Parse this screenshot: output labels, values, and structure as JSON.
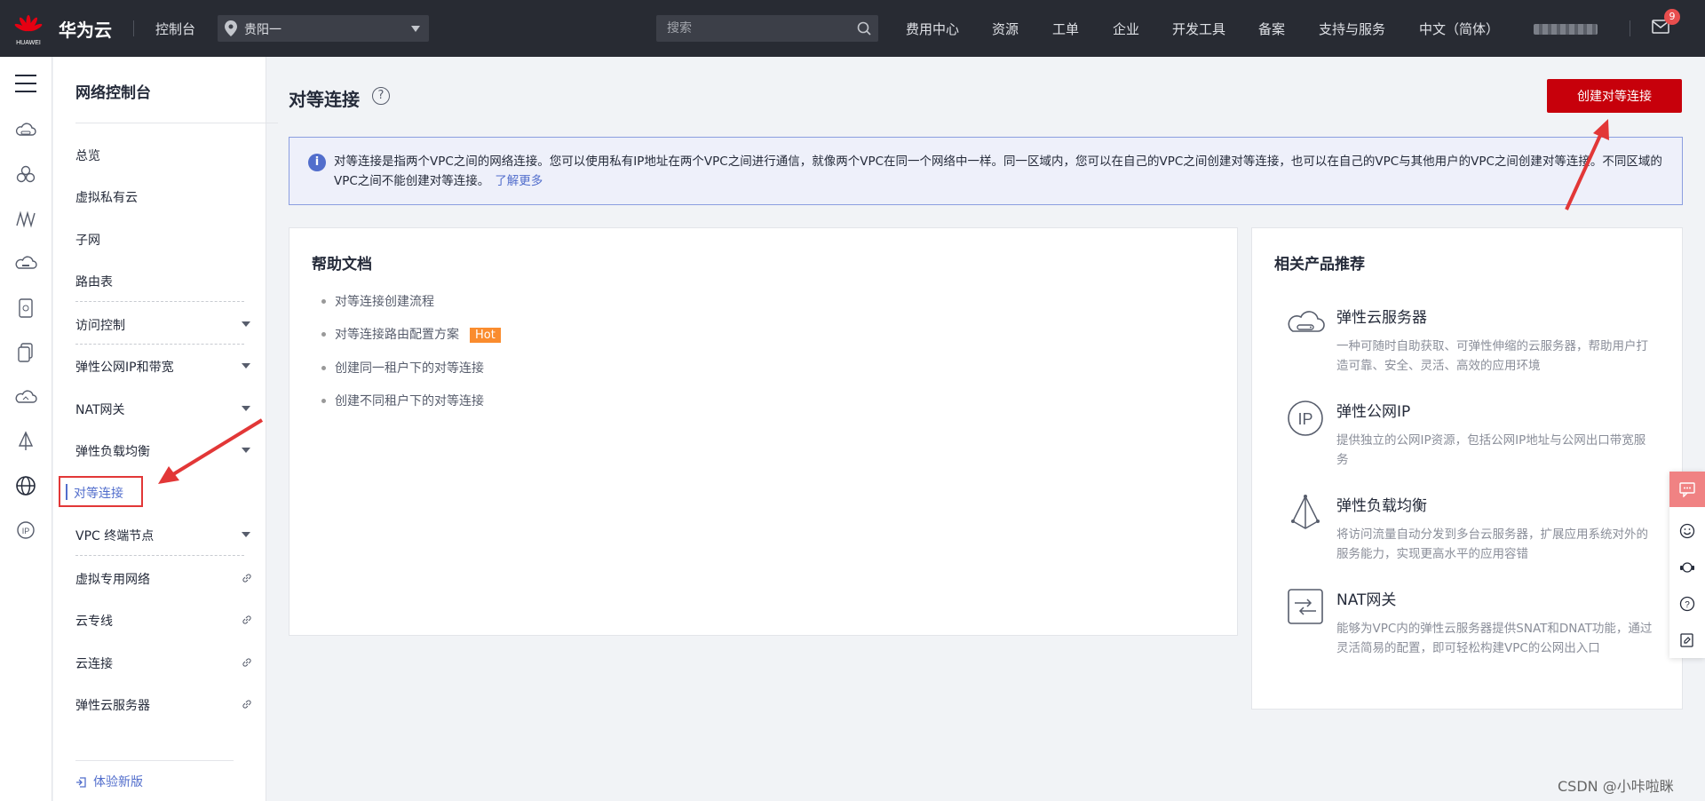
{
  "topbar": {
    "logo_text": "华为云",
    "logo_brand": "HUAWEI",
    "console": "控制台",
    "region": "贵阳一",
    "search_placeholder": "搜索",
    "nav": [
      "费用中心",
      "资源",
      "工单",
      "企业",
      "开发工具",
      "备案",
      "支持与服务",
      "中文（简体）"
    ],
    "mail_badge": "9"
  },
  "sidebar": {
    "title": "网络控制台",
    "items": [
      {
        "label": "总览"
      },
      {
        "label": "虚拟私有云"
      },
      {
        "label": "子网"
      },
      {
        "label": "路由表"
      },
      {
        "label": "访问控制"
      },
      {
        "label": "弹性公网IP和带宽"
      },
      {
        "label": "NAT网关"
      },
      {
        "label": "弹性负载均衡"
      },
      {
        "label": "对等连接"
      },
      {
        "label": "VPC 终端节点"
      },
      {
        "label": "虚拟专用网络"
      },
      {
        "label": "云专线"
      },
      {
        "label": "云连接"
      },
      {
        "label": "弹性云服务器"
      }
    ],
    "new_version": "体验新版"
  },
  "main": {
    "title": "对等连接",
    "create_button": "创建对等连接",
    "info_text": "对等连接是指两个VPC之间的网络连接。您可以使用私有IP地址在两个VPC之间进行通信，就像两个VPC在同一个网络中一样。同一区域内，您可以在自己的VPC之间创建对等连接，也可以在自己的VPC与其他用户的VPC之间创建对等连接。不同区域的VPC之间不能创建对等连接。",
    "learn_more": "了解更多",
    "help_docs": {
      "title": "帮助文档",
      "items": [
        "对等连接创建流程",
        "对等连接路由配置方案",
        "创建同一租户下的对等连接",
        "创建不同租户下的对等连接"
      ],
      "hot_label": "Hot"
    },
    "related": {
      "title": "相关产品推荐",
      "products": [
        {
          "name": "弹性云服务器",
          "desc": "一种可随时自助获取、可弹性伸缩的云服务器，帮助用户打造可靠、安全、灵活、高效的应用环境",
          "icon": "cloud-server-icon"
        },
        {
          "name": "弹性公网IP",
          "desc": "提供独立的公网IP资源，包括公网IP地址与公网出口带宽服务",
          "icon": "ip-icon"
        },
        {
          "name": "弹性负载均衡",
          "desc": "将访问流量自动分发到多台云服务器，扩展应用系统对外的服务能力，实现更高水平的应用容错",
          "icon": "load-balancer-icon"
        },
        {
          "name": "NAT网关",
          "desc": "能够为VPC内的弹性云服务器提供SNAT和DNAT功能，通过灵活简易的配置，即可轻松构建VPC的公网出入口",
          "icon": "nat-gateway-icon"
        }
      ]
    }
  },
  "watermark": "CSDN @小咔啦眯",
  "colors": {
    "brand_red": "#c7000b",
    "topbar": "#282b33",
    "link": "#526ecc",
    "annotation": "#e23737"
  }
}
